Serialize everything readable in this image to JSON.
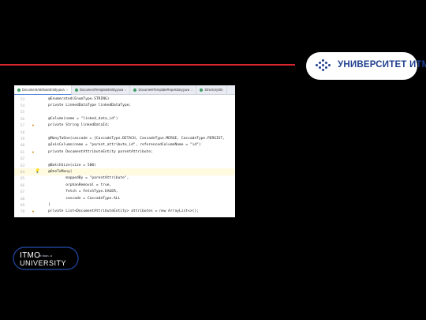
{
  "slide": {
    "logo_text": "УНИВЕРСИТЕТ ИТМО",
    "bottom_logo_line1": "ITMO",
    "bottom_logo_small": "re.than. a",
    "bottom_logo_line2": "UNIVERSITY"
  },
  "editor": {
    "tabs": [
      {
        "label": "DocumentAttributeEntity.java",
        "active": true
      },
      {
        "label": "DocumentTemplateEntity.java",
        "active": false
      },
      {
        "label": "DocumentTemplateRepository.java",
        "active": false
      },
      {
        "label": "DirectorySto",
        "active": false
      }
    ],
    "lines": [
      {
        "num": "53",
        "code": "    @Enumerated(EnumType.STRING)",
        "marker": ""
      },
      {
        "num": "54",
        "code": "    private LinkedDataType linkedDataType;",
        "marker": ""
      },
      {
        "num": "55",
        "code": "",
        "marker": ""
      },
      {
        "num": "56",
        "code": "    @Column(name = \"linked_data_id\")",
        "marker": ""
      },
      {
        "num": "57",
        "code": "    private String linkedDataId;",
        "marker": "o"
      },
      {
        "num": "58",
        "code": "",
        "marker": ""
      },
      {
        "num": "59",
        "code": "    @ManyToOne(cascade = {CascadeType.DETACH, CascadeType.MERGE, CascadeType.PERSIST,",
        "marker": ""
      },
      {
        "num": "60",
        "code": "    @JoinColumn(name = \"parent_attribute_id\", referencedColumnName = \"id\")",
        "marker": ""
      },
      {
        "num": "61",
        "code": "    private DocumentAttributeEntity parentAttribute;",
        "marker": "o"
      },
      {
        "num": "62",
        "code": "",
        "marker": ""
      },
      {
        "num": "63",
        "code": "    @BatchSize(size = 500)",
        "marker": ""
      },
      {
        "num": "64",
        "code": "    @OneToMany(",
        "marker": ""
      },
      {
        "num": "65",
        "code": "            mappedBy = \"parentAttribute\",",
        "marker": ""
      },
      {
        "num": "66",
        "code": "            orphanRemoval = true,",
        "marker": ""
      },
      {
        "num": "67",
        "code": "            fetch = FetchType.EAGER,",
        "marker": ""
      },
      {
        "num": "68",
        "code": "            cascade = CascadeType.ALL",
        "marker": ""
      },
      {
        "num": "69",
        "code": "    )",
        "marker": ""
      },
      {
        "num": "70",
        "code": "    private List<DocumentAttributeEntity> attributes = new ArrayList<>();",
        "marker": "o"
      }
    ]
  }
}
